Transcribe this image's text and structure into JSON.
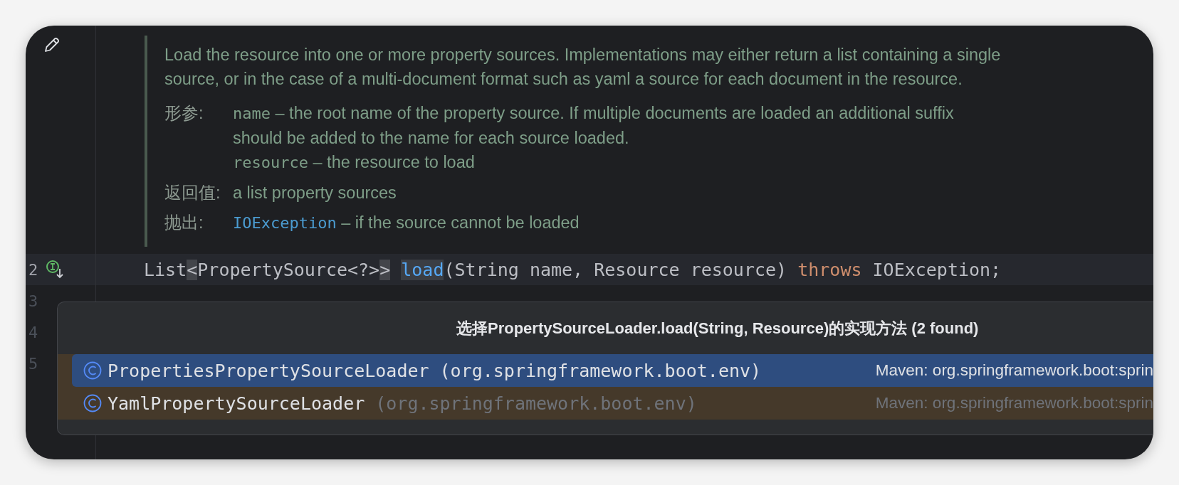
{
  "doc": {
    "summary": "Load the resource into one or more property sources. Implementations may either return a list containing a single source, or in the case of a multi-document format such as yaml a source for each document in the resource.",
    "sections": [
      {
        "label": "形参:",
        "entries": [
          {
            "code": "name",
            "text": " – the root name of the property source. If multiple documents are loaded an additional suffix should be added to the name for each source loaded.",
            "kind": "param"
          },
          {
            "code": "resource",
            "text": " – the resource to load",
            "kind": "param"
          }
        ]
      },
      {
        "label": "返回值:",
        "entries": [
          {
            "text": "a list property sources",
            "kind": "plain"
          }
        ]
      },
      {
        "label": "抛出:",
        "entries": [
          {
            "code": "IOException",
            "text": " – if the source cannot be loaded",
            "kind": "link"
          }
        ]
      }
    ]
  },
  "code_lines": [
    {
      "number": "2",
      "current": true,
      "tokens": [
        {
          "text": "List",
          "kind": "plain"
        },
        {
          "text": "<",
          "kind": "match"
        },
        {
          "text": "PropertySource<?>",
          "kind": "plain"
        },
        {
          "text": ">",
          "kind": "match"
        },
        {
          "text": "load",
          "kind": "method"
        },
        {
          "text": "(String name, Resource resource) ",
          "kind": "plain"
        },
        {
          "text": "throws",
          "kind": "keyword"
        },
        {
          "text": " IOException;",
          "kind": "plain"
        }
      ]
    },
    {
      "number": "3",
      "current": false
    },
    {
      "number": "4",
      "current": false
    },
    {
      "number": "5",
      "current": false
    }
  ],
  "popup": {
    "title": "选择PropertySourceLoader.load(String, Resource)的实现方法 (2 found)",
    "items": [
      {
        "name": "PropertiesPropertySourceLoader",
        "package": "(org.springframework.boot.env)",
        "location": "Maven: org.springframework.boot:sprin",
        "selected": true
      },
      {
        "name": "YamlPropertySourceLoader",
        "package": "(org.springframework.boot.env)",
        "location": "Maven: org.springframework.boot:sprin",
        "selected": false
      }
    ]
  }
}
